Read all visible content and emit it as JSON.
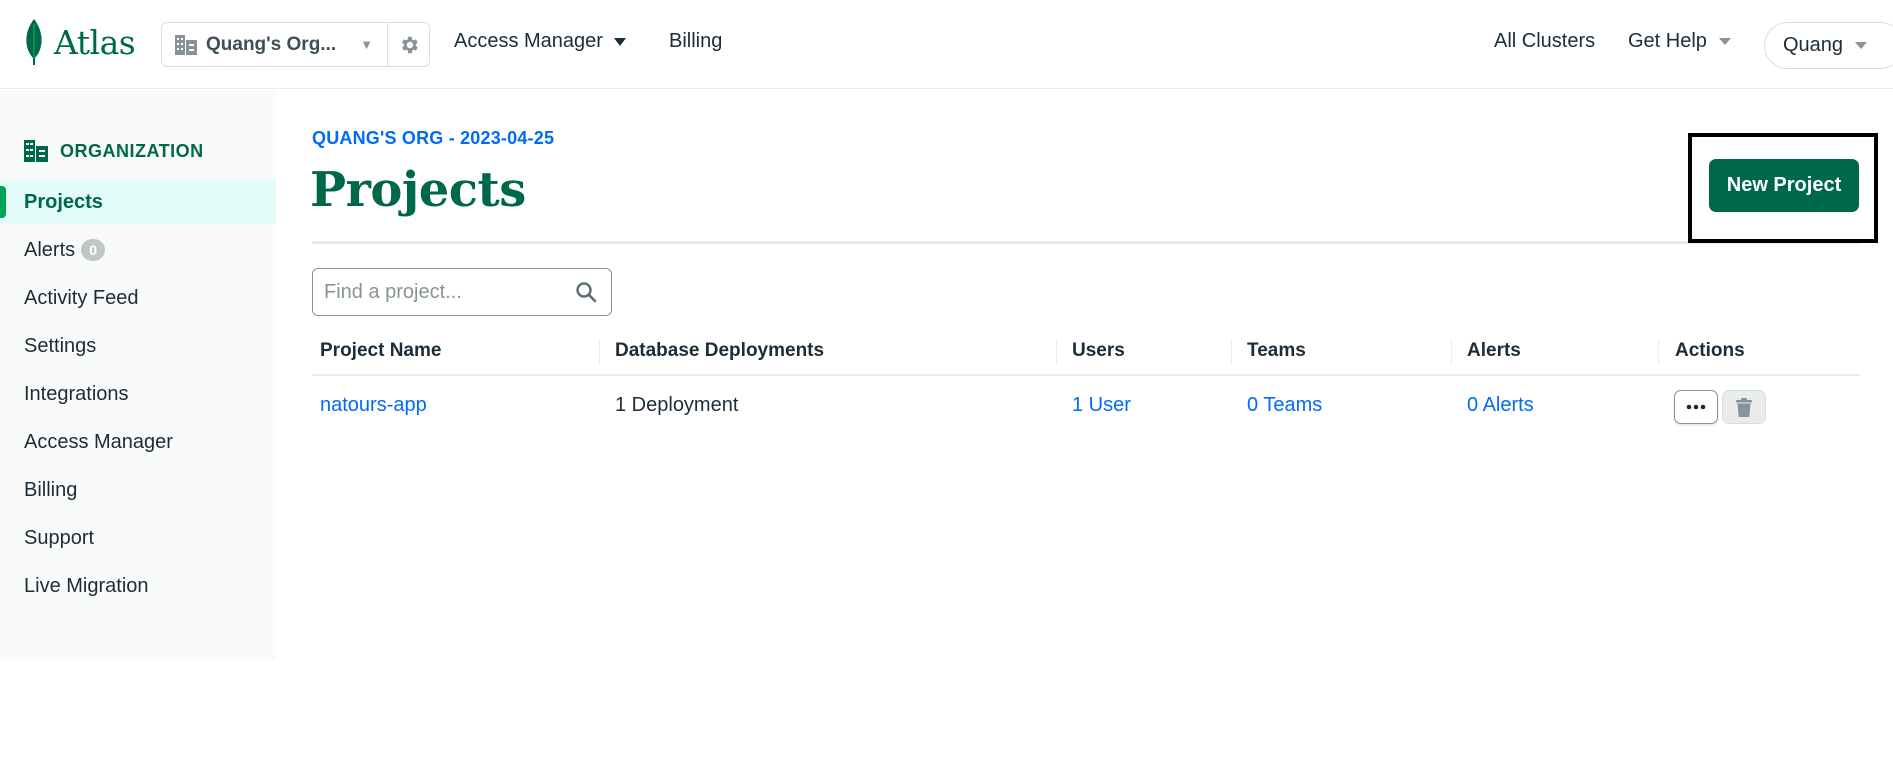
{
  "header": {
    "logo_text": "Atlas",
    "org_name": "Quang's Org...",
    "nav": [
      {
        "label": "Access Manager"
      },
      {
        "label": "Billing"
      }
    ],
    "right": {
      "all_clusters": "All Clusters",
      "get_help": "Get Help",
      "user": "Quang"
    }
  },
  "sidebar": {
    "heading": "ORGANIZATION",
    "items": [
      {
        "label": "Projects",
        "active": true
      },
      {
        "label": "Alerts",
        "badge": "0"
      },
      {
        "label": "Activity Feed"
      },
      {
        "label": "Settings"
      },
      {
        "label": "Integrations"
      },
      {
        "label": "Access Manager"
      },
      {
        "label": "Billing"
      },
      {
        "label": "Support"
      },
      {
        "label": "Live Migration"
      }
    ]
  },
  "main": {
    "breadcrumb": "QUANG'S ORG - 2023-04-25",
    "title": "Projects",
    "new_project_label": "New Project",
    "search": {
      "placeholder": "Find a project...",
      "value": ""
    },
    "table": {
      "columns": [
        "Project Name",
        "Database Deployments",
        "Users",
        "Teams",
        "Alerts",
        "Actions"
      ],
      "rows": [
        {
          "project_name": "natours-app",
          "deployments": "1 Deployment",
          "users": "1 User",
          "teams": "0 Teams",
          "alerts": "0 Alerts"
        }
      ]
    }
  },
  "colors": {
    "brand_green": "#00684a",
    "link_blue": "#016bf8",
    "active_bg": "#e3fcf7",
    "active_bar": "#00a35c",
    "sidebar_bg": "#f9fbfa"
  },
  "icons": [
    "leaf-logo-icon",
    "building-icon",
    "gear-icon",
    "chevron-down-icon",
    "search-icon",
    "ellipsis-icon",
    "trash-icon"
  ]
}
